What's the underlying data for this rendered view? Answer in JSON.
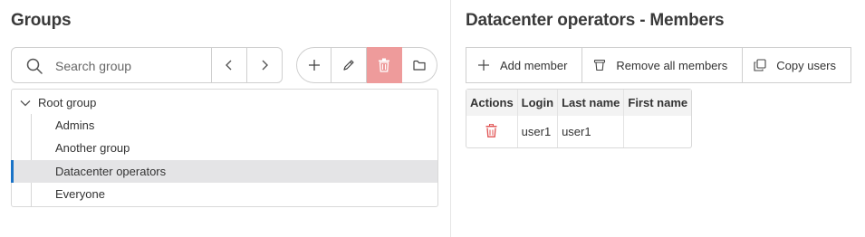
{
  "groups_panel": {
    "title": "Groups",
    "search": {
      "placeholder": "Search group",
      "value": ""
    },
    "tree": {
      "root_label": "Root group",
      "items": [
        {
          "label": "Admins",
          "selected": false
        },
        {
          "label": "Another group",
          "selected": false
        },
        {
          "label": "Datacenter operators",
          "selected": true
        },
        {
          "label": "Everyone",
          "selected": false
        }
      ]
    }
  },
  "members_panel": {
    "title": "Datacenter operators - Members",
    "toolbar": {
      "add_member": "Add member",
      "remove_all": "Remove all members",
      "copy_users": "Copy users"
    },
    "table": {
      "headers": [
        "Actions",
        "Login",
        "Last name",
        "First name"
      ],
      "rows": [
        {
          "login": "user1",
          "last_name": "user1",
          "first_name": ""
        }
      ]
    }
  },
  "colors": {
    "accent": "#1a73c7",
    "danger": "#ee9b9b",
    "danger_icon": "#e05050",
    "selected_bg": "#e4e4e6"
  }
}
